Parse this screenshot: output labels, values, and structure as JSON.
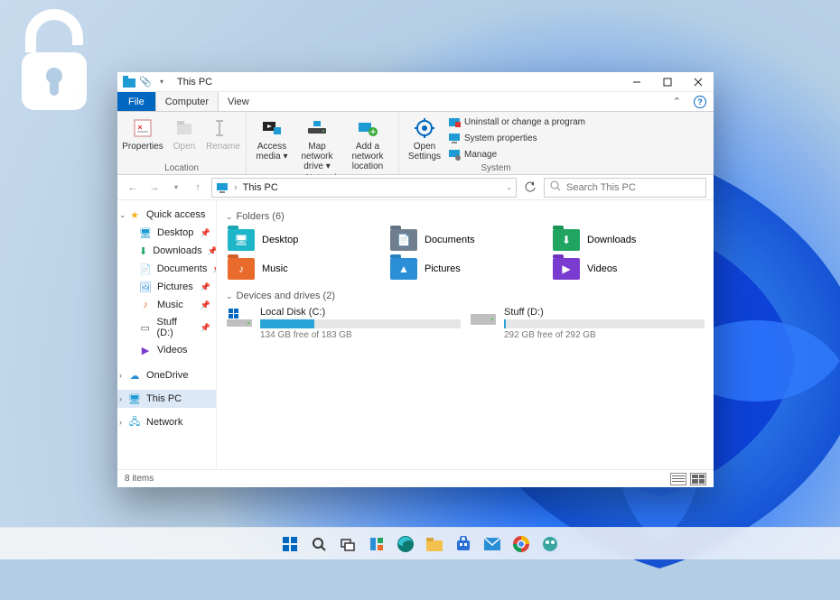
{
  "window": {
    "title": "This PC",
    "tabs": {
      "file": "File",
      "computer": "Computer",
      "view": "View"
    }
  },
  "ribbon": {
    "location": {
      "label": "Location",
      "properties": "Properties",
      "open": "Open",
      "rename": "Rename"
    },
    "network": {
      "label": "Network",
      "access_media": "Access media",
      "map_drive": "Map network drive",
      "add_location": "Add a network location"
    },
    "system": {
      "label": "System",
      "open_settings": "Open Settings",
      "uninstall": "Uninstall or change a program",
      "properties": "System properties",
      "manage": "Manage"
    }
  },
  "address": {
    "crumb": "This PC",
    "refresh_icon": "refresh",
    "search_placeholder": "Search This PC"
  },
  "sidebar": {
    "quick_access": "Quick access",
    "items": [
      {
        "label": "Desktop",
        "icon": "desktop"
      },
      {
        "label": "Downloads",
        "icon": "downloads"
      },
      {
        "label": "Documents",
        "icon": "documents"
      },
      {
        "label": "Pictures",
        "icon": "pictures"
      },
      {
        "label": "Music",
        "icon": "music"
      },
      {
        "label": "Stuff (D:)",
        "icon": "drive"
      },
      {
        "label": "Videos",
        "icon": "videos"
      }
    ],
    "onedrive": "OneDrive",
    "this_pc": "This PC",
    "network": "Network"
  },
  "sections": {
    "folders": {
      "label": "Folders (6)"
    },
    "devices": {
      "label": "Devices and drives (2)"
    }
  },
  "folders": [
    {
      "label": "Desktop",
      "color": "#20b6c9",
      "glyph": "🖥"
    },
    {
      "label": "Documents",
      "color": "#6f7f8f",
      "glyph": "📄"
    },
    {
      "label": "Downloads",
      "color": "#1fa560",
      "glyph": "⬇"
    },
    {
      "label": "Music",
      "color": "#e86b2c",
      "glyph": "♪"
    },
    {
      "label": "Pictures",
      "color": "#2a8fd6",
      "glyph": "▲"
    },
    {
      "label": "Videos",
      "color": "#7a3bd1",
      "glyph": "▶"
    }
  ],
  "drives": [
    {
      "name": "Local Disk (C:)",
      "free_text": "134 GB free of 183 GB",
      "used_pct": 27,
      "logo": true
    },
    {
      "name": "Stuff (D:)",
      "free_text": "292 GB free of 292 GB",
      "used_pct": 1,
      "logo": false
    }
  ],
  "status": {
    "items": "8 items"
  },
  "taskbar_icons": [
    "start",
    "search",
    "taskview",
    "widgets",
    "edge",
    "explorer",
    "store",
    "mail",
    "chrome",
    "app"
  ]
}
